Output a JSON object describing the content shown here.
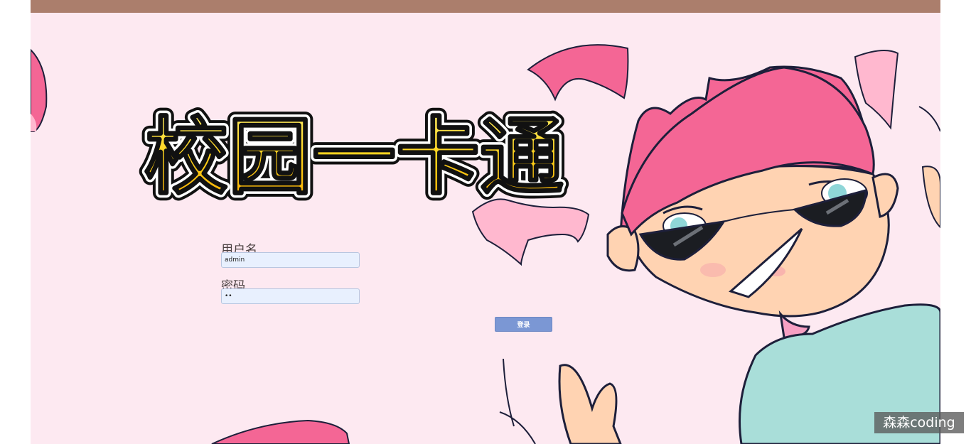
{
  "page": {
    "title": "校园一卡通"
  },
  "login_form": {
    "username_label": "用户名",
    "username_value": "admin",
    "password_label": "密码",
    "password_value": "12",
    "submit_label": "登录"
  },
  "watermark": {
    "text": "森森coding"
  },
  "colors": {
    "background": "#fde9f1",
    "top_bar": "#ab7e6c",
    "title_fill": "#ffd21a",
    "button": "#7b97d4",
    "hair_pink": "#f46695"
  }
}
